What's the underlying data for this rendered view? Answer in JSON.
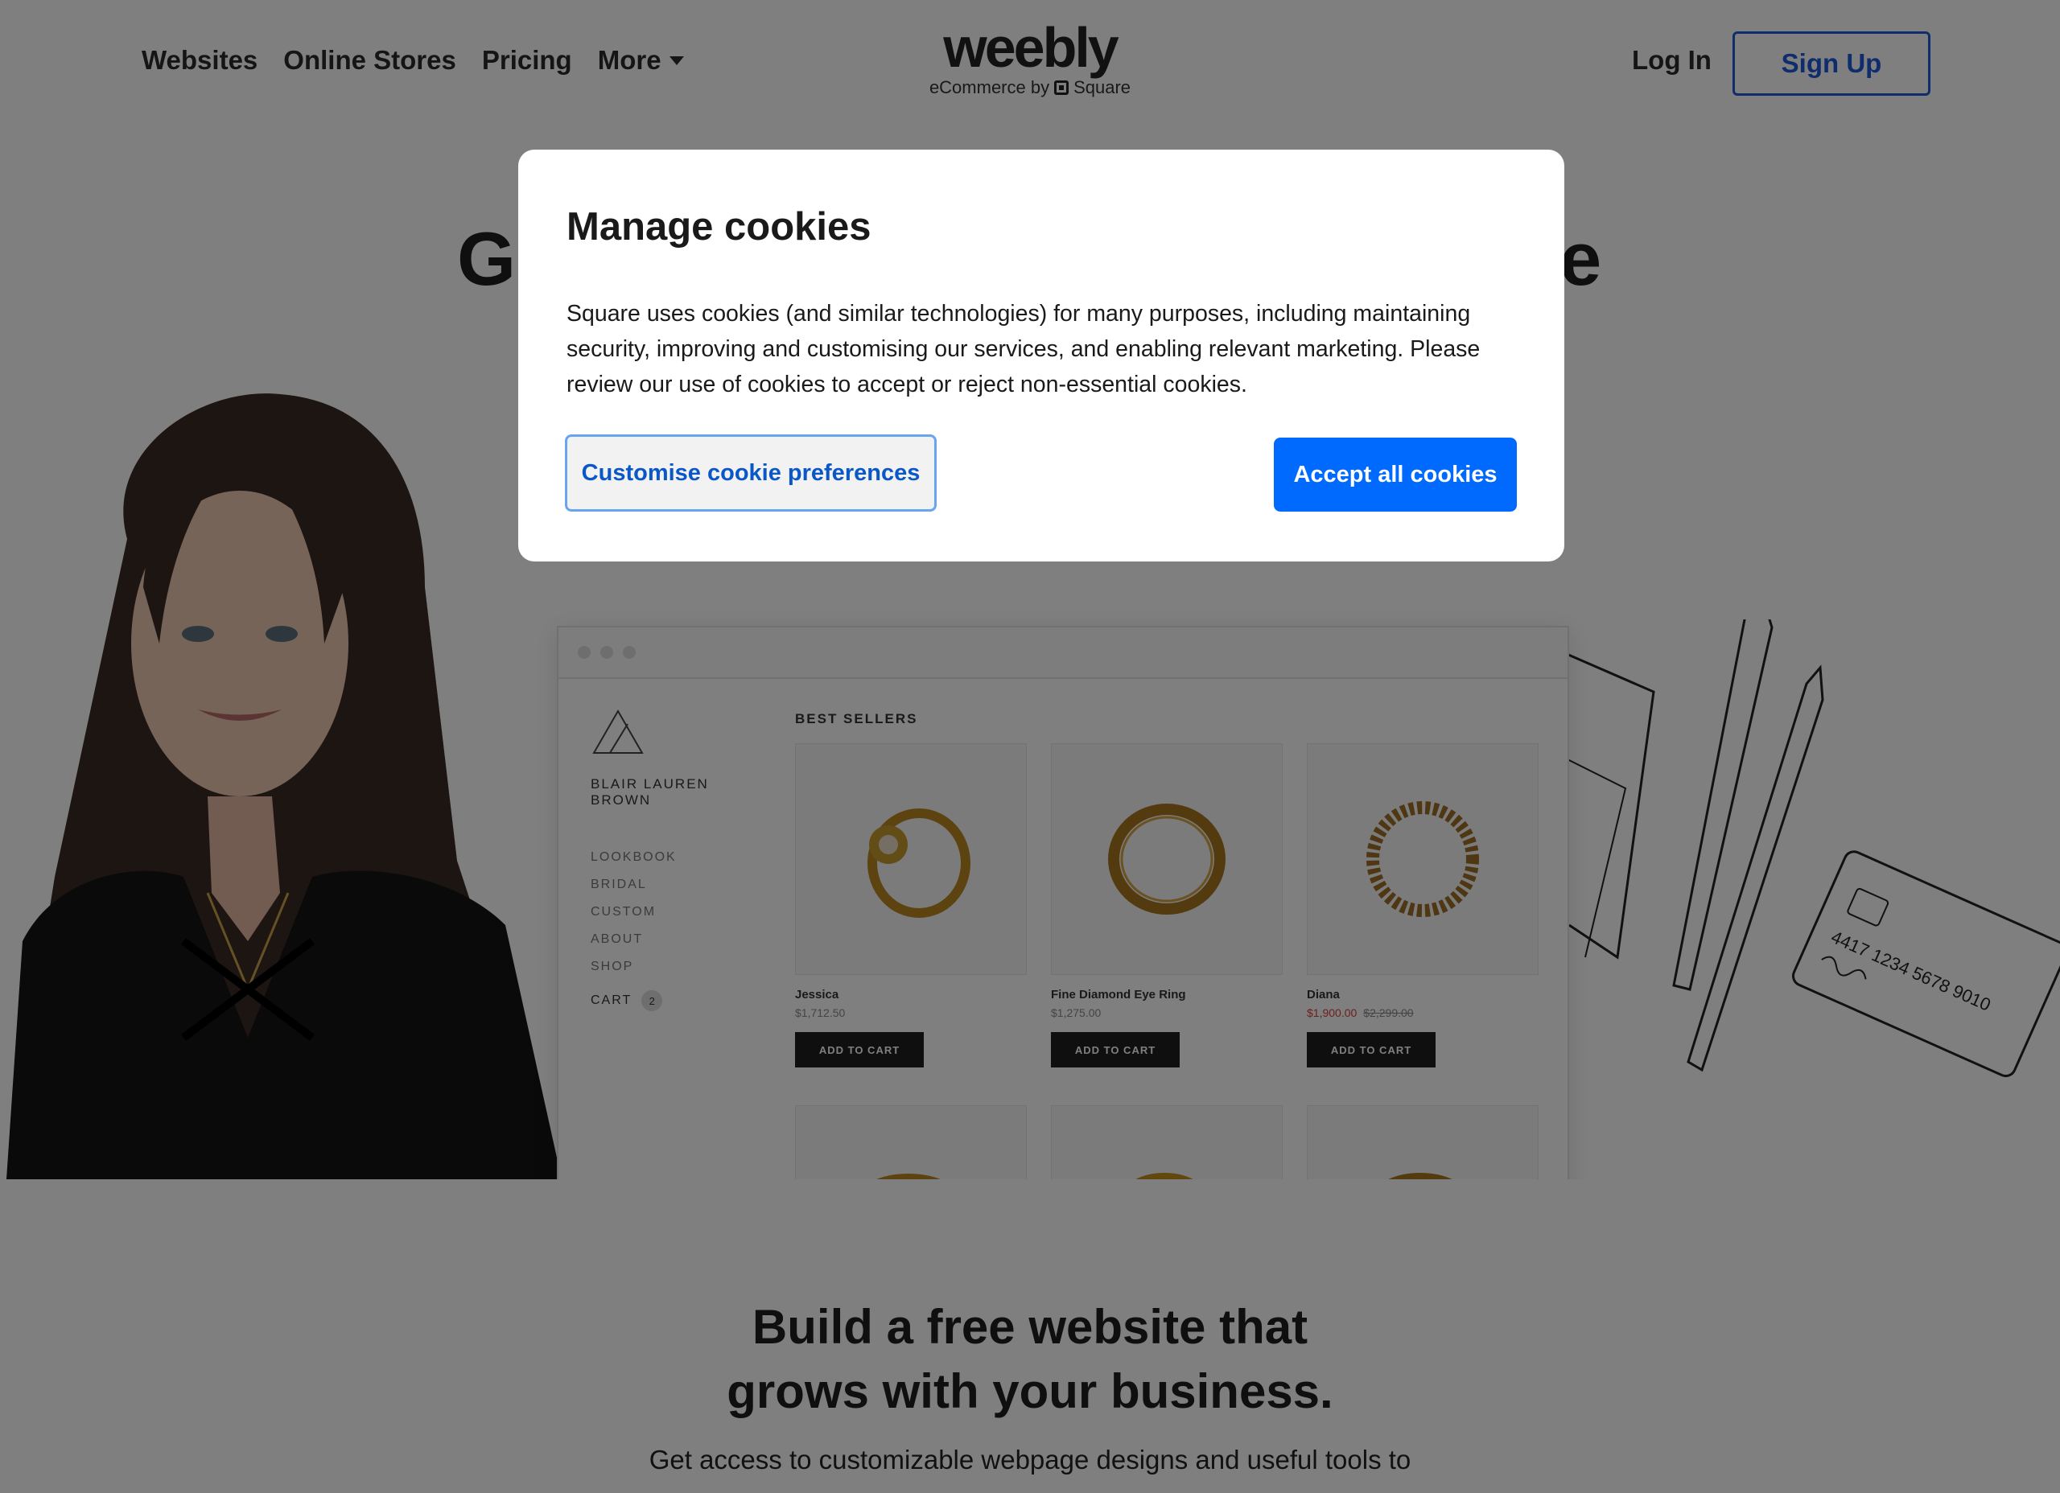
{
  "header": {
    "nav": [
      "Websites",
      "Online Stores",
      "Pricing",
      "More"
    ],
    "logo_word": "weebly",
    "logo_sub_prefix": "eCommerce by",
    "logo_sub_brand": "Square",
    "login_label": "Log In",
    "signup_label": "Sign Up",
    "signup_color": "#1f5ad8"
  },
  "hero": {
    "title_left": "G",
    "title_right": "e"
  },
  "store_mock": {
    "brand": "BLAIR LAUREN BROWN",
    "menu": [
      "LOOKBOOK",
      "BRIDAL",
      "CUSTOM",
      "ABOUT",
      "SHOP"
    ],
    "cart_label": "CART",
    "cart_count": "2",
    "section_title": "BEST SELLERS",
    "products": [
      {
        "name": "Jessica",
        "price": "$1,712.50",
        "was": "",
        "button": "ADD TO CART"
      },
      {
        "name": "Fine Diamond Eye Ring",
        "price": "$1,275.00",
        "was": "",
        "button": "ADD TO CART"
      },
      {
        "name": "Diana",
        "price": "$1,900.00",
        "was": "$2,299.00",
        "button": "ADD TO CART"
      }
    ],
    "sale_color": "#d9403a"
  },
  "doodle_card": {
    "number": "4417 1234 5678 9010"
  },
  "lower": {
    "title_line1": "Build a free website that",
    "title_line2": "grows with your business.",
    "subtitle": "Get access to customizable webpage designs and useful tools to"
  },
  "cookie_modal": {
    "title": "Manage cookies",
    "body": "Square uses cookies (and similar technologies) for many purposes, including maintaining security, improving and customising our services, and enabling relevant marketing. Please review our use of cookies to accept or reject non-essential cookies.",
    "customise_label": "Customise cookie preferences",
    "accept_label": "Accept all cookies",
    "accept_color": "#006aff"
  }
}
